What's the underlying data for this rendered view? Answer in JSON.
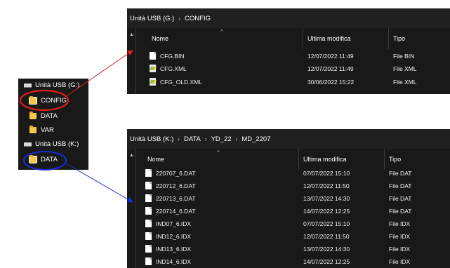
{
  "tree": {
    "items": [
      {
        "label": "Unità USB (G:)",
        "kind": "drive"
      },
      {
        "label": "CONFIG",
        "kind": "folder",
        "selected": true
      },
      {
        "label": "DATA",
        "kind": "folder"
      },
      {
        "label": "VAR",
        "kind": "folder"
      },
      {
        "label": "Unità USB (K:)",
        "kind": "drive"
      },
      {
        "label": "DATA",
        "kind": "folder",
        "selected": true
      }
    ]
  },
  "window1": {
    "breadcrumb": [
      "Unità USB (G:)",
      "CONFIG"
    ],
    "columns": [
      "Nome",
      "Ultima modifica",
      "Tipo"
    ],
    "rows": [
      {
        "name": "CFG.BIN",
        "modified": "12/07/2022 11:49",
        "type": "File BIN",
        "icon": "file-icon"
      },
      {
        "name": "CFG.XML",
        "modified": "12/07/2022 11:49",
        "type": "File XML",
        "icon": "xml-file-icon"
      },
      {
        "name": "CFG_OLD.XML",
        "modified": "30/06/2022 15:22",
        "type": "File XML",
        "icon": "xml-file-icon"
      }
    ]
  },
  "window2": {
    "breadcrumb": [
      "Unità USB (K:)",
      "DATA",
      "YD_22",
      "MD_2207"
    ],
    "columns": [
      "Nome",
      "Ultima modifica",
      "Tipo"
    ],
    "rows": [
      {
        "name": "220707_6.DAT",
        "modified": "07/07/2022 15:10",
        "type": "File DAT",
        "icon": "file-icon"
      },
      {
        "name": "220712_6.DAT",
        "modified": "12/07/2022 11:50",
        "type": "File DAT",
        "icon": "file-icon"
      },
      {
        "name": "220713_6.DAT",
        "modified": "13/07/2022 14:30",
        "type": "File DAT",
        "icon": "file-icon"
      },
      {
        "name": "220714_6.DAT",
        "modified": "14/07/2022 12:25",
        "type": "File DAT",
        "icon": "file-icon"
      },
      {
        "name": "IND07_6.IDX",
        "modified": "07/07/2022 15:10",
        "type": "File IDX",
        "icon": "file-icon"
      },
      {
        "name": "IND12_6.IDX",
        "modified": "12/07/2022 11:50",
        "type": "File IDX",
        "icon": "file-icon"
      },
      {
        "name": "IND13_6.IDX",
        "modified": "13/07/2022 14:30",
        "type": "File IDX",
        "icon": "file-icon"
      },
      {
        "name": "IND14_6.IDX",
        "modified": "14/07/2022 12:25",
        "type": "File IDX",
        "icon": "file-icon"
      }
    ]
  },
  "colors": {
    "highlight_red": "#e0201b",
    "highlight_blue": "#1a2bd6",
    "panel_bg": "#191919"
  }
}
